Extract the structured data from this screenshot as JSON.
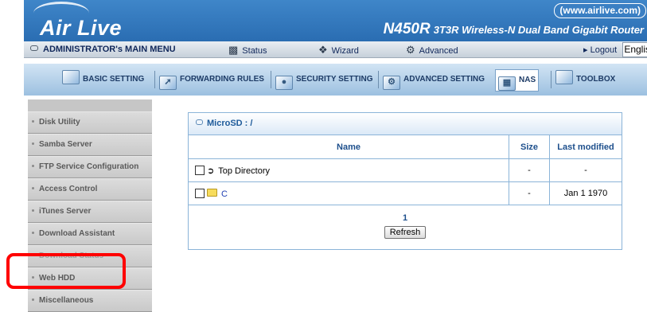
{
  "header": {
    "logo": "Air Live",
    "url": "(www.airlive.com)",
    "model": "N450R",
    "model_desc": "3T3R Wireless-N Dual Band Gigabit Router"
  },
  "main_menu": {
    "admin_label": "ADMINISTRATOR's MAIN MENU",
    "status": "Status",
    "wizard": "Wizard",
    "advanced": "Advanced",
    "logout": "Logout",
    "language": "English"
  },
  "tabs": [
    {
      "label": "BASIC SETTING"
    },
    {
      "label": "FORWARDING RULES"
    },
    {
      "label": "SECURITY SETTING"
    },
    {
      "label": "ADVANCED SETTING"
    },
    {
      "label": "NAS"
    },
    {
      "label": "TOOLBOX"
    }
  ],
  "sidebar": {
    "items": [
      {
        "label": "Disk Utility"
      },
      {
        "label": "Samba Server"
      },
      {
        "label": "FTP Service Configuration"
      },
      {
        "label": "Access Control"
      },
      {
        "label": "iTunes Server"
      },
      {
        "label": "Download Assistant"
      },
      {
        "label": "Download Status"
      },
      {
        "label": "Web HDD"
      },
      {
        "label": "Miscellaneous"
      }
    ]
  },
  "file_browser": {
    "path": "MicroSD : /",
    "columns": {
      "name": "Name",
      "size": "Size",
      "modified": "Last modified"
    },
    "rows": [
      {
        "name": "Top Directory",
        "size": "-",
        "modified": "-"
      },
      {
        "name": "C",
        "size": "-",
        "modified": "Jan 1 1970"
      }
    ],
    "page": "1",
    "refresh_label": "Refresh"
  },
  "colors": {
    "banner": "#2a6db2",
    "highlight": "#ff0000",
    "table_border": "#8bb4d8"
  }
}
